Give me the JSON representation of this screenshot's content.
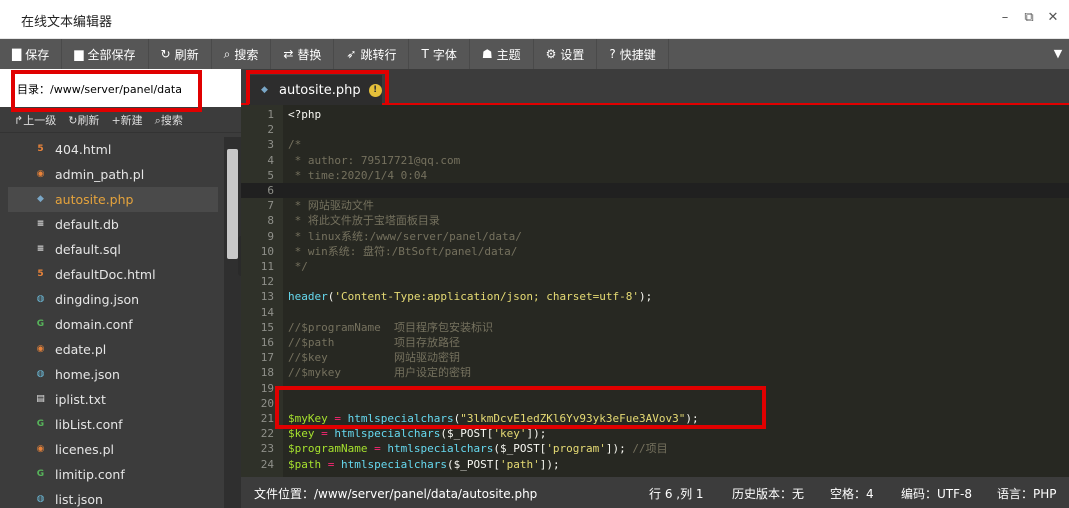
{
  "window": {
    "title": "在线文本编辑器"
  },
  "toolbar": {
    "buttons": [
      {
        "icon": "save-icon",
        "glyph": "▇",
        "label": "保存"
      },
      {
        "icon": "save-all-icon",
        "glyph": "▆",
        "label": "全部保存"
      },
      {
        "icon": "refresh-icon",
        "glyph": "↻",
        "label": "刷新"
      },
      {
        "icon": "search-icon",
        "glyph": "⌕",
        "label": "搜索"
      },
      {
        "icon": "replace-icon",
        "glyph": "⇄",
        "label": "替换"
      },
      {
        "icon": "goto-line-icon",
        "glyph": "➶",
        "label": "跳转行"
      },
      {
        "icon": "font-icon",
        "glyph": "T",
        "label": "字体"
      },
      {
        "icon": "theme-icon",
        "glyph": "☗",
        "label": "主题"
      },
      {
        "icon": "settings-icon",
        "glyph": "⚙",
        "label": "设置"
      },
      {
        "icon": "shortcut-icon",
        "glyph": "?",
        "label": "快捷键"
      }
    ]
  },
  "sidebar": {
    "directory": "目录：/www/server/panel/data",
    "actions": [
      {
        "glyph": "↱",
        "label": "上一级"
      },
      {
        "glyph": "↻",
        "label": "刷新"
      },
      {
        "glyph": "+",
        "label": "新建"
      },
      {
        "glyph": "⌕",
        "label": "搜索"
      }
    ],
    "files": [
      {
        "name": "404.html",
        "type": "html",
        "glyph": "5"
      },
      {
        "name": "admin_path.pl",
        "type": "pl",
        "glyph": "◉"
      },
      {
        "name": "autosite.php",
        "type": "php",
        "glyph": "◆",
        "active": true
      },
      {
        "name": "default.db",
        "type": "db",
        "glyph": "≡"
      },
      {
        "name": "default.sql",
        "type": "db",
        "glyph": "≡"
      },
      {
        "name": "defaultDoc.html",
        "type": "html",
        "glyph": "5"
      },
      {
        "name": "dingding.json",
        "type": "json",
        "glyph": "◍"
      },
      {
        "name": "domain.conf",
        "type": "conf",
        "glyph": "G"
      },
      {
        "name": "edate.pl",
        "type": "pl",
        "glyph": "◉"
      },
      {
        "name": "home.json",
        "type": "json",
        "glyph": "◍"
      },
      {
        "name": "iplist.txt",
        "type": "txt",
        "glyph": "▤"
      },
      {
        "name": "libList.conf",
        "type": "conf",
        "glyph": "G"
      },
      {
        "name": "licenes.pl",
        "type": "pl",
        "glyph": "◉"
      },
      {
        "name": "limitip.conf",
        "type": "conf",
        "glyph": "G"
      },
      {
        "name": "list.json",
        "type": "json",
        "glyph": "◍"
      }
    ]
  },
  "tabs": [
    {
      "label": "autosite.php",
      "warning": "!"
    }
  ],
  "editor": {
    "current_line": 6,
    "lines": [
      [
        {
          "c": "c-plain",
          "t": "<?php"
        }
      ],
      [],
      [
        {
          "c": "c-comment",
          "t": "/*"
        }
      ],
      [
        {
          "c": "c-comment",
          "t": " * author: 79517721@qq.com"
        }
      ],
      [
        {
          "c": "c-comment",
          "t": " * time:2020/1/4 0:04"
        }
      ],
      [
        {
          "c": "c-comment",
          "t": " "
        }
      ],
      [
        {
          "c": "c-comment",
          "t": " * 网站驱动文件"
        }
      ],
      [
        {
          "c": "c-comment",
          "t": " * 将此文件放于宝塔面板目录"
        }
      ],
      [
        {
          "c": "c-comment",
          "t": " * linux系统:/www/server/panel/data/"
        }
      ],
      [
        {
          "c": "c-comment",
          "t": " * win系统: 盘符:/BtSoft/panel/data/"
        }
      ],
      [
        {
          "c": "c-comment",
          "t": " */"
        }
      ],
      [],
      [
        {
          "c": "c-func",
          "t": "header"
        },
        {
          "c": "c-plain",
          "t": "("
        },
        {
          "c": "c-str",
          "t": "'Content-Type:application/json; charset=utf-8'"
        },
        {
          "c": "c-plain",
          "t": ");"
        }
      ],
      [],
      [
        {
          "c": "c-comment",
          "t": "//$programName  项目程序包安装标识"
        }
      ],
      [
        {
          "c": "c-comment",
          "t": "//$path         项目存放路径"
        }
      ],
      [
        {
          "c": "c-comment",
          "t": "//$key          网站驱动密钥"
        }
      ],
      [
        {
          "c": "c-comment",
          "t": "//$mykey        用户设定的密钥"
        }
      ],
      [],
      [],
      [
        {
          "c": "c-var",
          "t": "$myKey"
        },
        {
          "c": "c-op",
          "t": " = "
        },
        {
          "c": "c-func",
          "t": "htmlspecialchars"
        },
        {
          "c": "c-plain",
          "t": "("
        },
        {
          "c": "c-str",
          "t": "\"3lkmDcvE1edZKl6Yv93yk3eFue3AVov3\""
        },
        {
          "c": "c-plain",
          "t": ");"
        }
      ],
      [
        {
          "c": "c-var",
          "t": "$key"
        },
        {
          "c": "c-op",
          "t": " = "
        },
        {
          "c": "c-func",
          "t": "htmlspecialchars"
        },
        {
          "c": "c-plain",
          "t": "($_POST["
        },
        {
          "c": "c-str",
          "t": "'key'"
        },
        {
          "c": "c-plain",
          "t": "]);"
        }
      ],
      [
        {
          "c": "c-var",
          "t": "$programName"
        },
        {
          "c": "c-op",
          "t": " = "
        },
        {
          "c": "c-func",
          "t": "htmlspecialchars"
        },
        {
          "c": "c-plain",
          "t": "($_POST["
        },
        {
          "c": "c-str",
          "t": "'program'"
        },
        {
          "c": "c-plain",
          "t": "]); "
        },
        {
          "c": "c-comment",
          "t": "//项目"
        }
      ],
      [
        {
          "c": "c-var",
          "t": "$path"
        },
        {
          "c": "c-op",
          "t": " = "
        },
        {
          "c": "c-func",
          "t": "htmlspecialchars"
        },
        {
          "c": "c-plain",
          "t": "($_POST["
        },
        {
          "c": "c-str",
          "t": "'path'"
        },
        {
          "c": "c-plain",
          "t": "]);"
        }
      ]
    ]
  },
  "status": {
    "file_location": "文件位置：/www/server/panel/data/autosite.php",
    "cursor": "行 6 ,列 1",
    "history": "历史版本：无",
    "spaces": "空格：4",
    "encoding": "编码：UTF-8",
    "language": "语言：PHP"
  },
  "colors": {
    "accent_red": "#e00000",
    "active_file": "#e5a33c"
  }
}
